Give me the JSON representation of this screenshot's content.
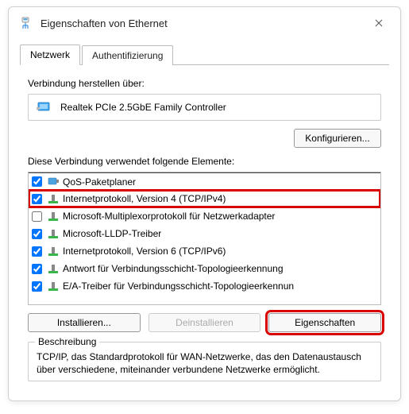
{
  "titlebar": {
    "title": "Eigenschaften von Ethernet"
  },
  "tabs": {
    "network": "Netzwerk",
    "auth": "Authentifizierung"
  },
  "connect_label": "Verbindung herstellen über:",
  "adapter": {
    "name": "Realtek PCIe 2.5GbE Family Controller"
  },
  "configure_button": "Konfigurieren...",
  "elements_label": "Diese Verbindung verwendet folgende Elemente:",
  "proto_list": {
    "qos": "QoS-Paketplaner",
    "ipv4": "Internetprotokoll, Version 4 (TCP/IPv4)",
    "multiplexor": "Microsoft-Multiplexorprotokoll für Netzwerkadapter",
    "lldp": "Microsoft-LLDP-Treiber",
    "ipv6": "Internetprotokoll, Version 6 (TCP/IPv6)",
    "responder": "Antwort für Verbindungsschicht-Topologieerkennung",
    "mapper": "E/A-Treiber für Verbindungsschicht-Topologieerkennun"
  },
  "buttons": {
    "install": "Installieren...",
    "uninstall": "Deinstallieren",
    "properties": "Eigenschaften"
  },
  "description": {
    "title": "Beschreibung",
    "text": "TCP/IP, das Standardprotokoll für WAN-Netzwerke, das den Datenaustausch über verschiedene, miteinander verbundene Netzwerke ermöglicht."
  }
}
